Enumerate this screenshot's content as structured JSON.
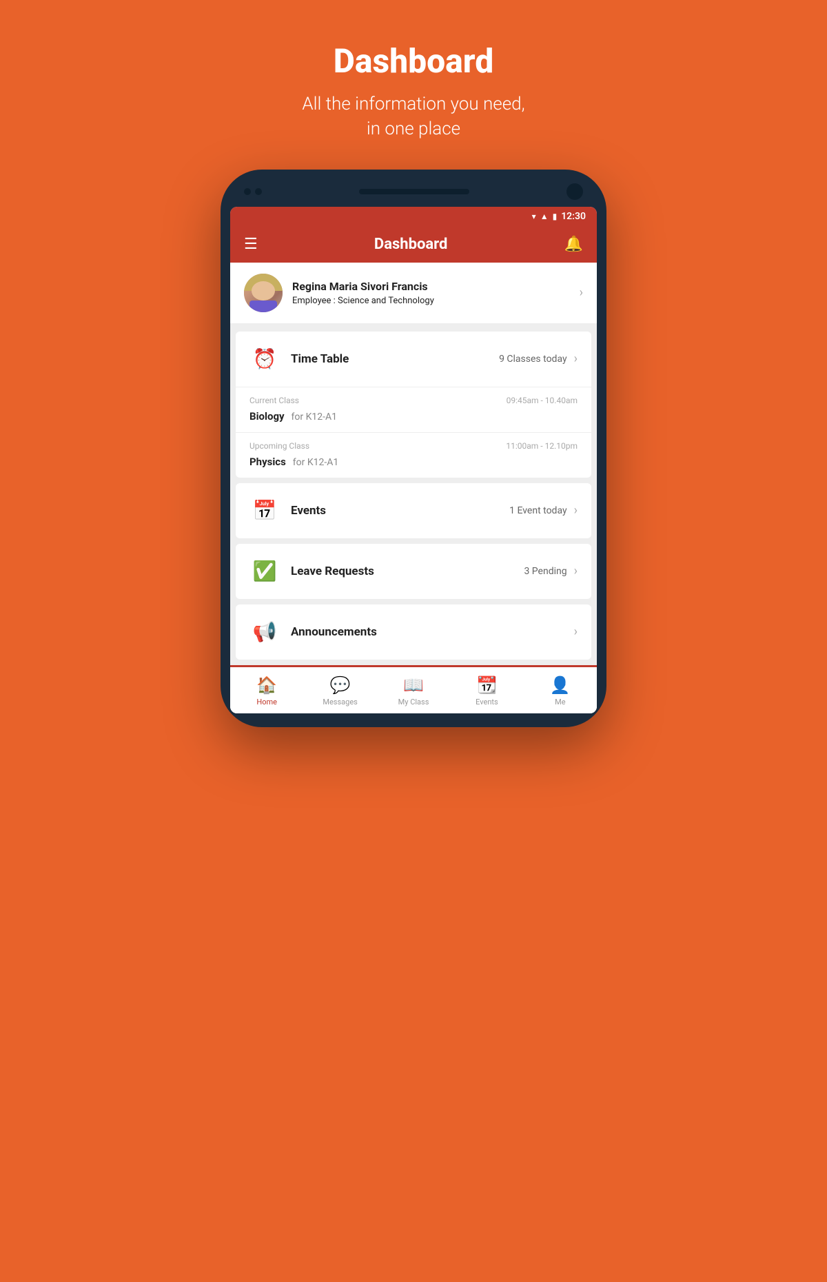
{
  "page": {
    "title": "Dashboard",
    "subtitle_line1": "All the information you need,",
    "subtitle_line2": "in one place"
  },
  "status_bar": {
    "time": "12:30"
  },
  "app_bar": {
    "title": "Dashboard"
  },
  "profile": {
    "name": "Regina Maria Sivori Francis",
    "role_label": "Employee : ",
    "role_value": "Science and Technology"
  },
  "timetable": {
    "title": "Time Table",
    "badge": "9 Classes today",
    "current_class": {
      "label": "Current Class",
      "time": "09:45am - 10.40am",
      "subject": "Biology",
      "class_for": "for K12-A1"
    },
    "upcoming_class": {
      "label": "Upcoming Class",
      "time": "11:00am - 12.10pm",
      "subject": "Physics",
      "class_for": "for K12-A1"
    }
  },
  "events": {
    "title": "Events",
    "badge": "1 Event today"
  },
  "leave_requests": {
    "title": "Leave Requests",
    "badge": "3 Pending"
  },
  "announcements": {
    "title": "Announcements"
  },
  "bottom_nav": {
    "items": [
      {
        "label": "Home",
        "active": true
      },
      {
        "label": "Messages",
        "active": false
      },
      {
        "label": "My Class",
        "active": false
      },
      {
        "label": "Events",
        "active": false
      },
      {
        "label": "Me",
        "active": false
      }
    ]
  }
}
